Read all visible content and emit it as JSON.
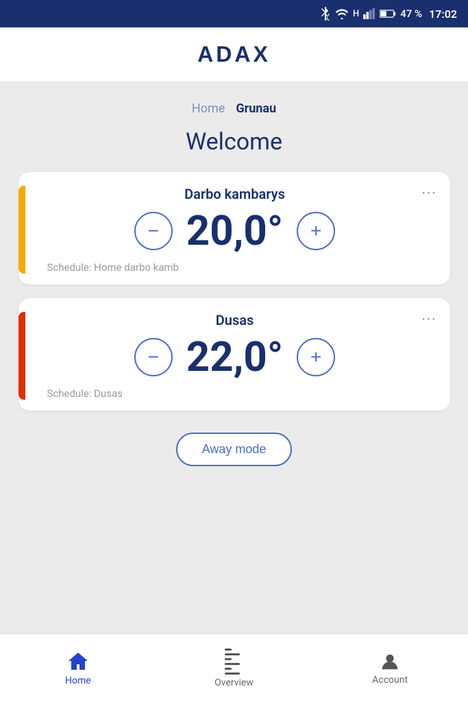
{
  "statusBar": {
    "battery": "47 %",
    "time": "17:02"
  },
  "header": {
    "logo": "ADAX"
  },
  "breadcrumb": {
    "home": "Home",
    "current": "Grunau"
  },
  "welcome": "Welcome",
  "devices": [
    {
      "id": "darbo-kambarys",
      "name": "Darbo kambarys",
      "temperature": "20,0°",
      "schedule": "Schedule: Home darbo kamb",
      "accent": "yellow"
    },
    {
      "id": "dusas",
      "name": "Dusas",
      "temperature": "22,0°",
      "schedule": "Schedule: Dusas",
      "accent": "red"
    }
  ],
  "awayMode": {
    "label": "Away mode"
  },
  "bottomNav": {
    "items": [
      {
        "id": "home",
        "label": "Home",
        "active": true
      },
      {
        "id": "overview",
        "label": "Overview",
        "active": false
      },
      {
        "id": "account",
        "label": "Account",
        "active": false
      }
    ]
  }
}
